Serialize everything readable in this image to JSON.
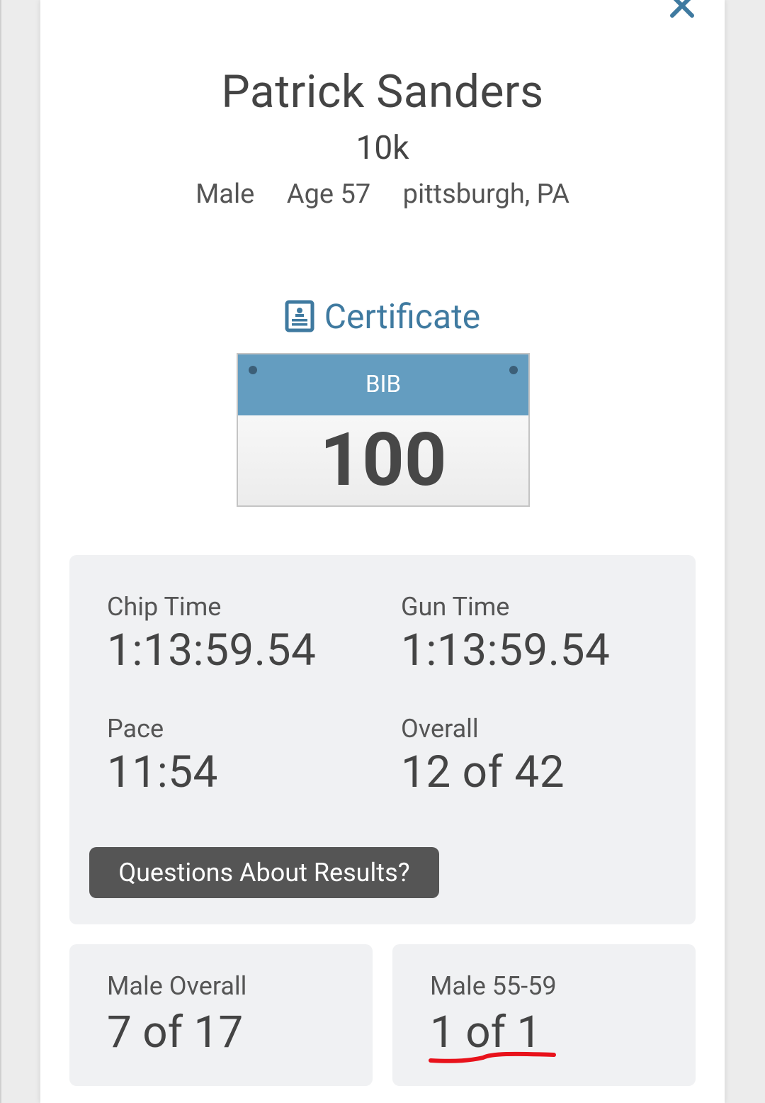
{
  "participant": {
    "name": "Patrick Sanders",
    "race": "10k",
    "gender": "Male",
    "age": "Age 57",
    "location": "pittsburgh, PA"
  },
  "certificate": {
    "label": "Certificate",
    "icon": "certificate-icon"
  },
  "close": {
    "icon": "close-icon"
  },
  "bib": {
    "label": "BIB",
    "number": "100"
  },
  "stats": {
    "chip_time": {
      "label": "Chip Time",
      "value": "1:13:59.54"
    },
    "gun_time": {
      "label": "Gun Time",
      "value": "1:13:59.54"
    },
    "pace": {
      "label": "Pace",
      "value": "11:54"
    },
    "overall": {
      "label": "Overall",
      "value": "12 of 42"
    }
  },
  "questions_button": {
    "label": "Questions About Results?"
  },
  "placements": {
    "gender_overall": {
      "label": "Male Overall",
      "value": "7 of 17"
    },
    "age_group": {
      "label": "Male 55-59",
      "value": "1 of 1"
    }
  },
  "colors": {
    "accent": "#3f7aa0",
    "bib_header": "#649dc0",
    "annotation_underline": "#e8121b"
  }
}
